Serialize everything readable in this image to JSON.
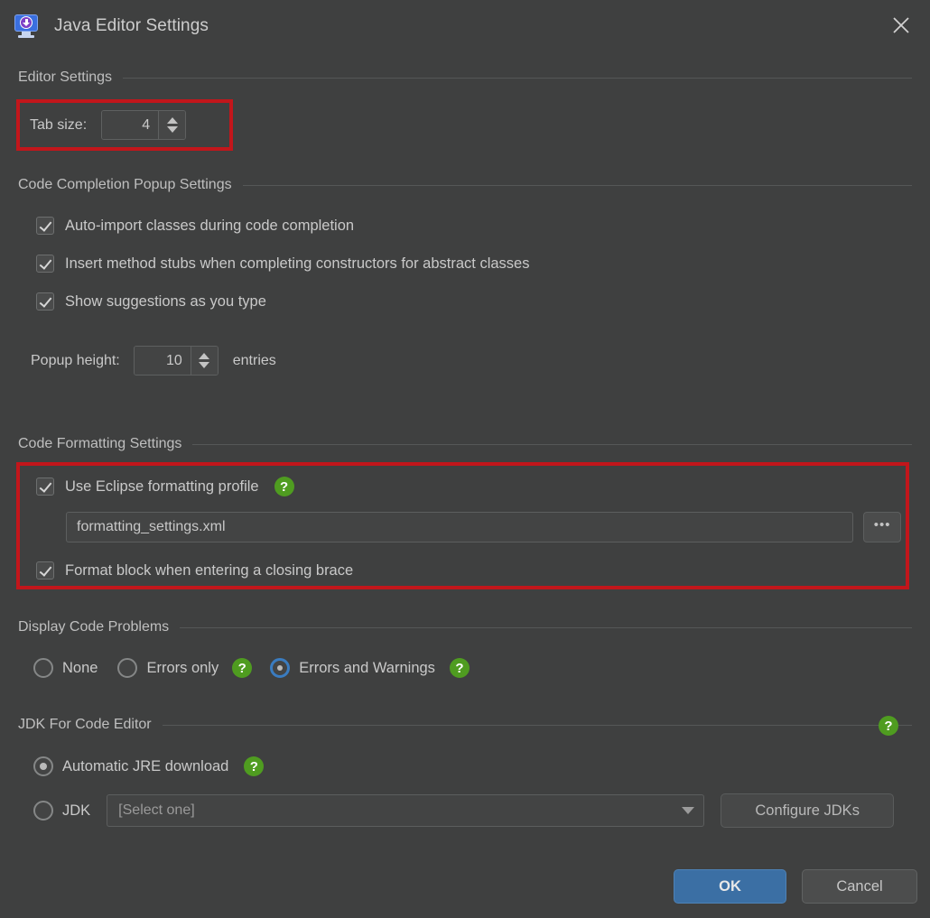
{
  "window": {
    "title": "Java Editor Settings",
    "icon": "java-monitor-icon",
    "close_label": "✕"
  },
  "sections": {
    "editor": {
      "heading": "Editor Settings",
      "tab_size_label": "Tab size:",
      "tab_size_value": "4"
    },
    "completion": {
      "heading": "Code Completion Popup Settings",
      "checkboxes": [
        {
          "label": "Auto-import classes during code completion",
          "checked": true
        },
        {
          "label": "Insert method stubs when completing constructors for abstract classes",
          "checked": true
        },
        {
          "label": "Show suggestions as you type",
          "checked": true
        }
      ],
      "popup_height_label": "Popup height:",
      "popup_height_value": "10",
      "popup_height_units": "entries"
    },
    "formatting": {
      "heading": "Code Formatting Settings",
      "use_eclipse_label": "Use Eclipse formatting profile",
      "use_eclipse_checked": true,
      "help_glyph": "?",
      "profile_path": "formatting_settings.xml",
      "browse_label": "•••",
      "format_block_label": "Format block when entering a closing brace",
      "format_block_checked": true
    },
    "problems": {
      "heading": "Display Code Problems",
      "options": [
        {
          "label": "None",
          "selected": false,
          "help": false
        },
        {
          "label": "Errors only",
          "selected": false,
          "help": true
        },
        {
          "label": "Errors and Warnings",
          "selected": true,
          "help": true
        }
      ]
    },
    "jdk": {
      "heading": "JDK For Code Editor",
      "heading_help_glyph": "?",
      "auto_label": "Automatic JRE download",
      "auto_selected": true,
      "auto_help_glyph": "?",
      "jdk_label": "JDK",
      "jdk_selected": false,
      "jdk_placeholder": "[Select one]",
      "configure_label": "Configure JDKs"
    }
  },
  "footer": {
    "ok_label": "OK",
    "cancel_label": "Cancel"
  },
  "colors": {
    "background": "#3f4040",
    "accent_blue": "#3b6fa4",
    "help_green": "#4f9c20",
    "highlight_red": "#c2161b"
  }
}
